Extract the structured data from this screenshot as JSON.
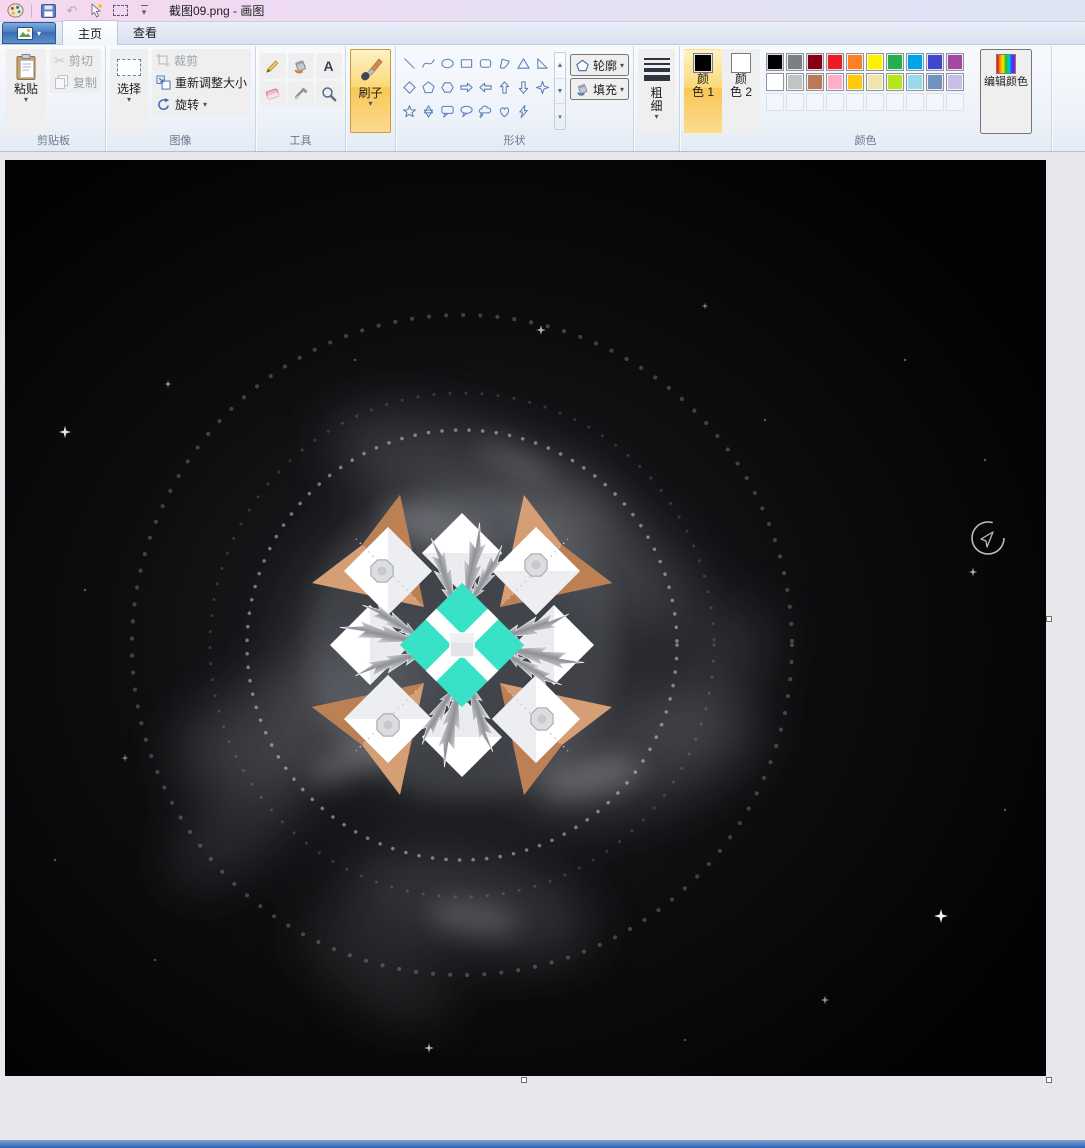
{
  "titlebar": {
    "title": "截图09.png - 画图"
  },
  "tabs": [
    {
      "label": "主页",
      "active": true
    },
    {
      "label": "查看",
      "active": false
    }
  ],
  "ribbon": {
    "clipboard": {
      "group_label": "剪贴板",
      "paste_label": "粘贴",
      "cut_label": "剪切",
      "copy_label": "复制"
    },
    "image": {
      "group_label": "图像",
      "select_label": "选择",
      "crop_label": "裁剪",
      "resize_label": "重新调整大小",
      "rotate_label": "旋转"
    },
    "tools": {
      "group_label": "工具",
      "items": [
        "pencil",
        "fill-bucket",
        "text",
        "eraser",
        "color-picker",
        "magnifier"
      ]
    },
    "brushes": {
      "button_label": "刷子"
    },
    "shapes": {
      "group_label": "形状",
      "outline_label": "轮廓",
      "fill_label": "填充",
      "items": [
        "line",
        "curve",
        "oval",
        "rectangle",
        "rounded-rectangle",
        "polygon",
        "triangle",
        "right-triangle",
        "diamond",
        "pentagon",
        "hexagon",
        "right-arrow",
        "left-arrow",
        "up-arrow",
        "down-arrow",
        "four-point-star",
        "five-point-star",
        "six-point-star",
        "rounded-callout",
        "oval-callout",
        "cloud-callout",
        "heart",
        "lightning"
      ]
    },
    "size": {
      "button_label": "粗细"
    },
    "colors": {
      "group_label": "颜色",
      "color1_line1": "颜",
      "color1_line2": "色 1",
      "color2_line1": "颜",
      "color2_line2": "色 2",
      "edit_label": "编辑颜色",
      "color1": "#000000",
      "color2": "#ffffff",
      "palette_row1": [
        "#000000",
        "#7f7f7f",
        "#880015",
        "#ed1c24",
        "#ff7f27",
        "#fff200",
        "#22b14c",
        "#00a2e8",
        "#3f48cc",
        "#a349a4"
      ],
      "palette_row2": [
        "#ffffff",
        "#c3c3c3",
        "#b97a57",
        "#ffaec9",
        "#ffc90e",
        "#efe4b0",
        "#b5e61d",
        "#99d9ea",
        "#7092be",
        "#c8bfe7"
      ],
      "empty_slots": 10
    }
  },
  "icons": {
    "caret_down": "▾",
    "scissors": "✂",
    "text_tool": "A",
    "undo_arrow": "↶",
    "scroll_up": "▲",
    "scroll_down": "▼",
    "scroll_more": "▾"
  },
  "canvas": {
    "accent_colors": {
      "background": "#050506",
      "mandala_tan": "#d69e74",
      "mandala_cyan": "#38e2c6",
      "mandala_white": "#ffffff",
      "mandala_gray": "#9aa0ab"
    }
  }
}
